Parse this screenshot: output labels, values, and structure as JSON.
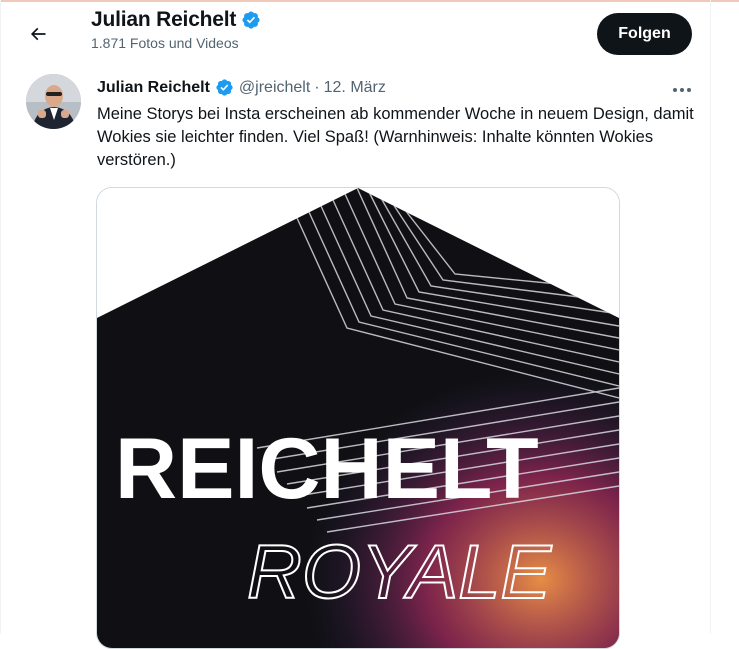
{
  "header": {
    "name": "Julian Reichelt",
    "subtitle": "1.871 Fotos und Videos",
    "follow_label": "Folgen"
  },
  "tweet": {
    "name": "Julian Reichelt",
    "handle": "@jreichelt",
    "separator": "·",
    "date": "12. März",
    "text": "Meine Storys bei Insta erscheinen ab kommender Woche in neuem Design, damit Wokies sie leichter finden. Viel Spaß! (Warnhinweis: Inhalte könnten Wokies verstören.)",
    "media": {
      "title_line1": "REICHELT",
      "title_line2": "ROYALE"
    }
  },
  "icons": {
    "back": "arrow-left-icon",
    "verified": "verified-badge-icon",
    "more": "more-horizontal-icon"
  },
  "colors": {
    "verified_blue": "#1d9bf0",
    "follow_bg": "#0f1419",
    "muted_text": "#536471"
  }
}
